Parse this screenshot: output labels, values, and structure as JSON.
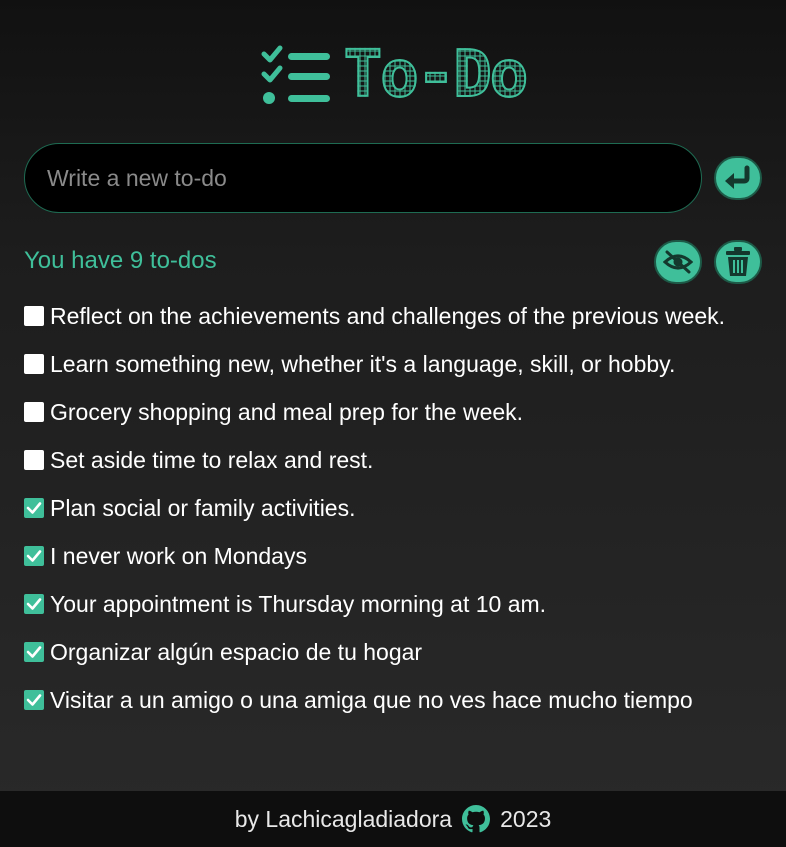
{
  "header": {
    "logo_icon": "checklist-icon",
    "title": "To-Do"
  },
  "input": {
    "placeholder": "Write a new to-do",
    "value": "",
    "submit_icon": "enter-arrow-icon"
  },
  "summary": {
    "count_text": "You have 9 to-dos",
    "hide_icon": "eye-slash-icon",
    "delete_icon": "trash-icon"
  },
  "todos": [
    {
      "text": "Reflect on the achievements and challenges of the previous week.",
      "done": false
    },
    {
      "text": "Learn something new, whether it's a language, skill, or hobby.",
      "done": false
    },
    {
      "text": "Grocery shopping and meal prep for the week.",
      "done": false
    },
    {
      "text": "Set aside time to relax and rest.",
      "done": false
    },
    {
      "text": "Plan social or family activities.",
      "done": true
    },
    {
      "text": "I never work on Mondays",
      "done": true
    },
    {
      "text": "Your appointment is Thursday morning at 10 am.",
      "done": true
    },
    {
      "text": "Organizar algún espacio de tu hogar",
      "done": true
    },
    {
      "text": "Visitar a un amigo o una amiga que no ves hace mucho tiempo",
      "done": true
    }
  ],
  "footer": {
    "by_text": "by Lachicagladiadora",
    "github_icon": "github-icon",
    "year": "2023"
  },
  "colors": {
    "accent": "#3fbf9a",
    "accent_dark": "#1d5a47",
    "input_bg": "#000000",
    "footer_bg": "#0e0e0e"
  }
}
